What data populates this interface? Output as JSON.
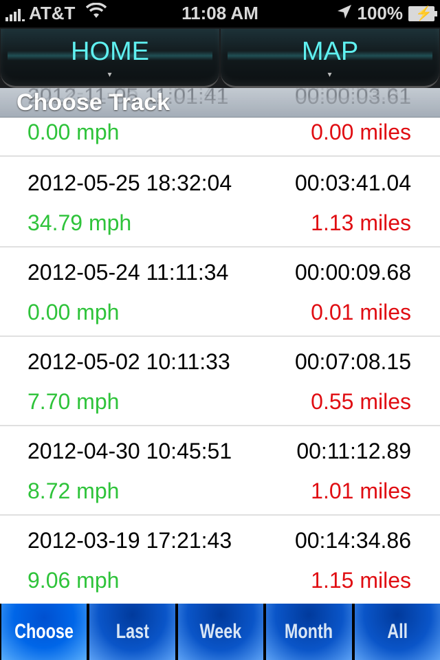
{
  "status_bar": {
    "carrier": "AT&T",
    "time": "11:08 AM",
    "battery": "100%",
    "icons": [
      "signal-icon",
      "wifi-icon",
      "location-arrow-icon",
      "battery-charging-icon"
    ]
  },
  "top_nav": {
    "home_label": "HOME",
    "map_label": "MAP"
  },
  "section_header": {
    "title": "Choose Track",
    "scrolled_row_date": "2012-11-05 11:01:41",
    "scrolled_row_duration": "00:00:03.61"
  },
  "tracks": [
    {
      "date": "2012-11-05 11:01:41",
      "duration": "00:00:03.61",
      "speed": "0.00 mph",
      "distance": "0.00 miles"
    },
    {
      "date": "2012-05-25 18:32:04",
      "duration": "00:03:41.04",
      "speed": "34.79 mph",
      "distance": "1.13 miles"
    },
    {
      "date": "2012-05-24 11:11:34",
      "duration": "00:00:09.68",
      "speed": "0.00 mph",
      "distance": "0.01 miles"
    },
    {
      "date": "2012-05-02 10:11:33",
      "duration": "00:07:08.15",
      "speed": "7.70 mph",
      "distance": "0.55 miles"
    },
    {
      "date": "2012-04-30 10:45:51",
      "duration": "00:11:12.89",
      "speed": "8.72 mph",
      "distance": "1.01 miles"
    },
    {
      "date": "2012-03-19 17:21:43",
      "duration": "00:14:34.86",
      "speed": "9.06 mph",
      "distance": "1.15 miles"
    }
  ],
  "tab_bar": {
    "tabs": [
      {
        "label": "Choose",
        "active": true
      },
      {
        "label": "Last",
        "active": false
      },
      {
        "label": "Week",
        "active": false
      },
      {
        "label": "Month",
        "active": false
      },
      {
        "label": "All",
        "active": false
      }
    ]
  },
  "colors": {
    "speed": "#2ec33a",
    "distance": "#e00d12",
    "nav_label": "#5ff0f0",
    "tab_blue": "#0a55c8"
  }
}
